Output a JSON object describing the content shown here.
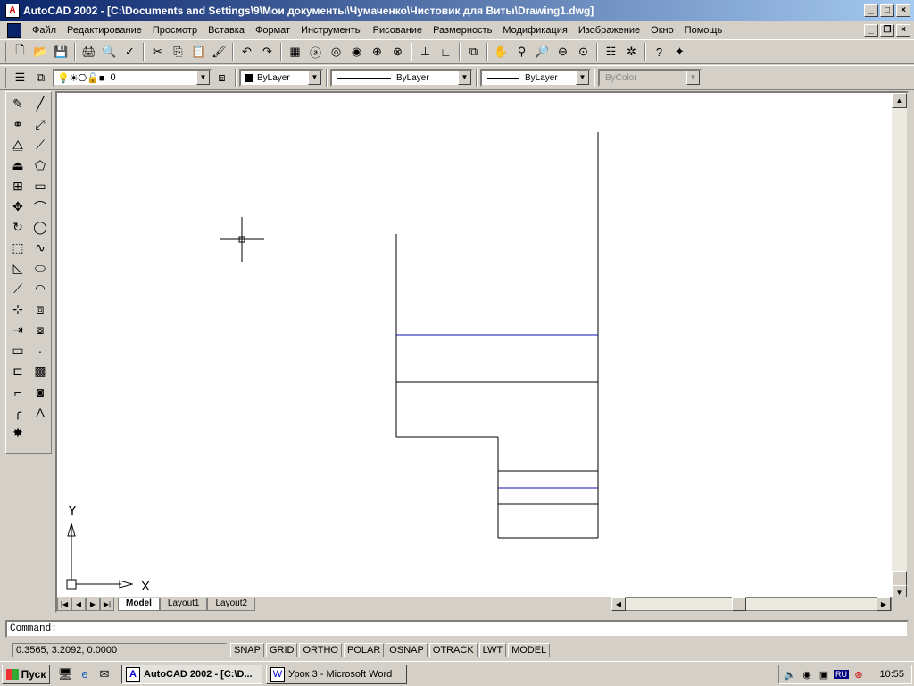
{
  "window": {
    "title": "AutoCAD 2002 - [C:\\Documents and Settings\\9\\Мои документы\\Чумаченко\\Чистовик для Виты\\Drawing1.dwg]"
  },
  "menu": [
    "Файл",
    "Редактирование",
    "Просмотр",
    "Вставка",
    "Формат",
    "Инструменты",
    "Рисование",
    "Размерность",
    "Модификация",
    "Изображение",
    "Окно",
    "Помощь"
  ],
  "standard_toolbar": [
    {
      "name": "new-icon",
      "glyph": "🗋"
    },
    {
      "name": "open-icon",
      "glyph": "📂"
    },
    {
      "name": "save-icon",
      "glyph": "💾"
    },
    {
      "name": "sep"
    },
    {
      "name": "print-icon",
      "glyph": "🖨"
    },
    {
      "name": "print-preview-icon",
      "glyph": "🔍"
    },
    {
      "name": "spellcheck-icon",
      "glyph": "✓"
    },
    {
      "name": "sep"
    },
    {
      "name": "cut-icon",
      "glyph": "✂"
    },
    {
      "name": "copy-icon",
      "glyph": "⎘"
    },
    {
      "name": "paste-icon",
      "glyph": "📋"
    },
    {
      "name": "match-properties-icon",
      "glyph": "🖌"
    },
    {
      "name": "sep"
    },
    {
      "name": "undo-icon",
      "glyph": "↶"
    },
    {
      "name": "redo-icon",
      "glyph": "↷"
    },
    {
      "name": "sep"
    },
    {
      "name": "design-center-icon",
      "glyph": "▦"
    },
    {
      "name": "today-icon",
      "glyph": "ⓐ"
    },
    {
      "name": "web-icon",
      "glyph": "◎"
    },
    {
      "name": "web-browse-icon",
      "glyph": "◉"
    },
    {
      "name": "publish-icon",
      "glyph": "⊕"
    },
    {
      "name": "hyperlink-icon",
      "glyph": "⊗"
    },
    {
      "name": "sep"
    },
    {
      "name": "ucs-icon",
      "glyph": "⊥"
    },
    {
      "name": "ucs-world-icon",
      "glyph": "∟"
    },
    {
      "name": "sep"
    },
    {
      "name": "aerial-view-icon",
      "glyph": "⧉"
    },
    {
      "name": "sep"
    },
    {
      "name": "pan-icon",
      "glyph": "✋"
    },
    {
      "name": "zoom-realtime-icon",
      "glyph": "⚲"
    },
    {
      "name": "zoom-window-icon",
      "glyph": "🔎"
    },
    {
      "name": "zoom-previous-icon",
      "glyph": "⊖"
    },
    {
      "name": "zoom-extents-icon",
      "glyph": "⊙"
    },
    {
      "name": "sep"
    },
    {
      "name": "properties-icon",
      "glyph": "☷"
    },
    {
      "name": "tool-palette-icon",
      "glyph": "✲"
    },
    {
      "name": "sep"
    },
    {
      "name": "help-icon",
      "glyph": "?"
    },
    {
      "name": "help-topics-icon",
      "glyph": "✦"
    }
  ],
  "layer_toolbar": {
    "layer_value": "0",
    "color_value": "ByLayer",
    "linetype_value": "ByLayer",
    "lineweight_value": "ByLayer",
    "plotstyle_value": "ByColor"
  },
  "draw_toolbar": [
    {
      "name": "line-icon",
      "glyph": "╱"
    },
    {
      "name": "construction-line-icon",
      "glyph": "⤢"
    },
    {
      "name": "polyline-icon",
      "glyph": "⟋"
    },
    {
      "name": "polygon-icon",
      "glyph": "⬠"
    },
    {
      "name": "rectangle-icon",
      "glyph": "▭"
    },
    {
      "name": "arc-icon",
      "glyph": "⌒"
    },
    {
      "name": "circle-icon",
      "glyph": "◯"
    },
    {
      "name": "spline-icon",
      "glyph": "∿"
    },
    {
      "name": "ellipse-icon",
      "glyph": "⬭"
    },
    {
      "name": "ellipse-arc-icon",
      "glyph": "◠"
    },
    {
      "name": "insert-block-icon",
      "glyph": "⧈"
    },
    {
      "name": "make-block-icon",
      "glyph": "⧇"
    },
    {
      "name": "point-icon",
      "glyph": "·"
    },
    {
      "name": "hatch-icon",
      "glyph": "▩"
    },
    {
      "name": "region-icon",
      "glyph": "◙"
    },
    {
      "name": "multiline-text-icon",
      "glyph": "A"
    }
  ],
  "modify_toolbar": [
    {
      "name": "erase-icon",
      "glyph": "✎"
    },
    {
      "name": "copy-object-icon",
      "glyph": "⚭"
    },
    {
      "name": "mirror-icon",
      "glyph": "⧋"
    },
    {
      "name": "offset-icon",
      "glyph": "⏏"
    },
    {
      "name": "array-icon",
      "glyph": "⊞"
    },
    {
      "name": "move-icon",
      "glyph": "✥"
    },
    {
      "name": "rotate-icon",
      "glyph": "↻"
    },
    {
      "name": "scale-icon",
      "glyph": "⬚"
    },
    {
      "name": "stretch-icon",
      "glyph": "◺"
    },
    {
      "name": "lengthen-icon",
      "glyph": "⟋"
    },
    {
      "name": "trim-icon",
      "glyph": "⊹"
    },
    {
      "name": "extend-icon",
      "glyph": "⇥"
    },
    {
      "name": "break-icon",
      "glyph": "▭"
    },
    {
      "name": "join-icon",
      "glyph": "⊏"
    },
    {
      "name": "chamfer-icon",
      "glyph": "⌐"
    },
    {
      "name": "fillet-icon",
      "glyph": "╭"
    },
    {
      "name": "explode-icon",
      "glyph": "✸"
    }
  ],
  "layout_tabs": [
    "Model",
    "Layout1",
    "Layout2"
  ],
  "ucs": {
    "x_label": "X",
    "y_label": "Y"
  },
  "command": {
    "prompt": "Command:"
  },
  "status": {
    "coords": "0.3565,  3.2092, 0.0000",
    "toggles": [
      "SNAP",
      "GRID",
      "ORTHO",
      "POLAR",
      "OSNAP",
      "OTRACK",
      "LWT",
      "MODEL"
    ]
  },
  "taskbar": {
    "start_label": "Пуск",
    "items": [
      {
        "label": "AutoCAD 2002 - [C:\\D...",
        "active": true,
        "icon": "A"
      },
      {
        "label": "Урок 3 - Microsoft Word",
        "active": false,
        "icon": "W"
      }
    ],
    "lang": "RU",
    "clock": "10:55"
  },
  "colors": {
    "line_blue": "#1010b0",
    "titlebar_start": "#0a246a"
  }
}
